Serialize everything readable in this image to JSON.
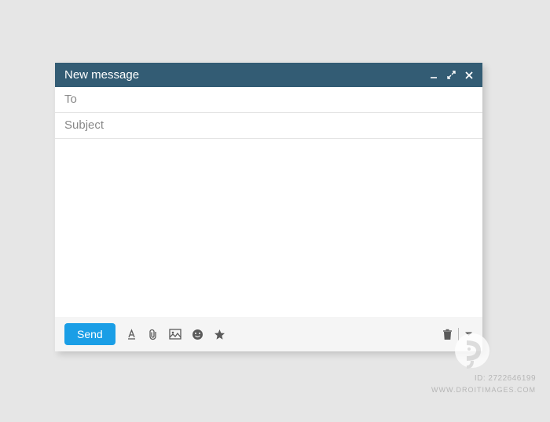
{
  "window": {
    "title": "New message"
  },
  "fields": {
    "to_placeholder": "To",
    "to_value": "",
    "subject_placeholder": "Subject",
    "subject_value": "",
    "body_value": ""
  },
  "toolbar": {
    "send_label": "Send"
  },
  "watermark": {
    "id_label": "ID: 2722646199",
    "url_label": "WWW.DROITIMAGES.COM"
  }
}
